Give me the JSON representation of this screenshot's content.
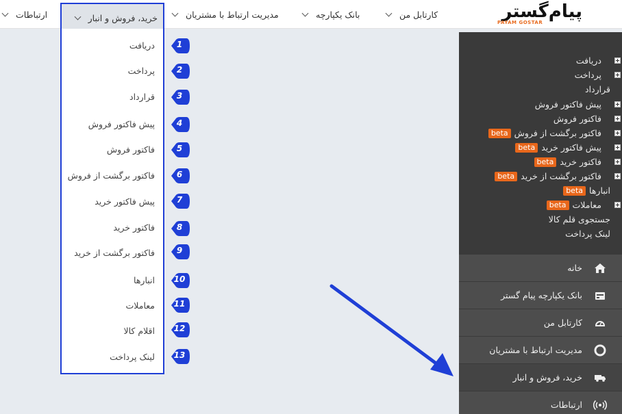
{
  "topnav": {
    "logo_text": "پیام‌گستر",
    "logo_sub": "PAYAM GOSTAR",
    "items": [
      {
        "label": "کارتابل من"
      },
      {
        "label": "بانک یکپارچه"
      },
      {
        "label": "مدیریت ارتباط با مشتریان"
      },
      {
        "label": "خرید، فروش و انبار"
      },
      {
        "label": "ارتباطات"
      }
    ]
  },
  "dropdown": {
    "items": [
      {
        "label": "دریافت",
        "marker": "1"
      },
      {
        "label": "پرداخت",
        "marker": "2"
      },
      {
        "label": "قرارداد",
        "marker": "3"
      },
      {
        "label": "پیش فاکتور فروش",
        "marker": "4"
      },
      {
        "label": "فاکتور فروش",
        "marker": "5"
      },
      {
        "label": "فاکتور برگشت از فروش",
        "marker": "6"
      },
      {
        "label": "پیش فاکتور خرید",
        "marker": "7"
      },
      {
        "label": "فاکتور خرید",
        "marker": "8"
      },
      {
        "label": "فاکتور برگشت از خرید",
        "marker": "9"
      },
      {
        "label": "انبارها",
        "marker": "10"
      },
      {
        "label": "معاملات",
        "marker": "11"
      },
      {
        "label": "اقلام کالا",
        "marker": "12"
      },
      {
        "label": "لینک پرداخت",
        "marker": "13"
      }
    ]
  },
  "sidepanel": {
    "items": [
      {
        "label": "دریافت",
        "badge": ""
      },
      {
        "label": "پرداخت",
        "badge": ""
      },
      {
        "label": "قرارداد",
        "badge": ""
      },
      {
        "label": "پیش فاکتور فروش",
        "badge": ""
      },
      {
        "label": "فاکتور فروش",
        "badge": ""
      },
      {
        "label": "فاکتور برگشت از فروش",
        "badge": "beta"
      },
      {
        "label": "پیش فاکتور خرید",
        "badge": "beta"
      },
      {
        "label": "فاکتور خرید",
        "badge": "beta"
      },
      {
        "label": "فاکتور برگشت از خرید",
        "badge": "beta"
      },
      {
        "label": "انبارها",
        "badge": "beta"
      },
      {
        "label": "معاملات",
        "badge": "beta"
      },
      {
        "label": "جستجوی قلم کالا",
        "badge": ""
      },
      {
        "label": "لینک پرداخت",
        "badge": ""
      }
    ]
  },
  "mainmenu": {
    "items": [
      {
        "label": "خانه",
        "icon": "home-icon"
      },
      {
        "label": "بانک یکپارچه پیام گستر",
        "icon": "database-icon"
      },
      {
        "label": "کارتابل من",
        "icon": "gauge-icon"
      },
      {
        "label": "مدیریت ارتباط با مشتریان",
        "icon": "lifebuoy-icon"
      },
      {
        "label": "خرید، فروش و انبار",
        "icon": "truck-icon"
      },
      {
        "label": "ارتباطات",
        "icon": "broadcast-icon"
      }
    ]
  },
  "colors": {
    "highlight_border": "#1f3fd6",
    "marker_fill": "#1f3fd6",
    "badge": "#e8671b",
    "panel_dark": "#3a3a3a",
    "menu": "#4d4d4d"
  }
}
